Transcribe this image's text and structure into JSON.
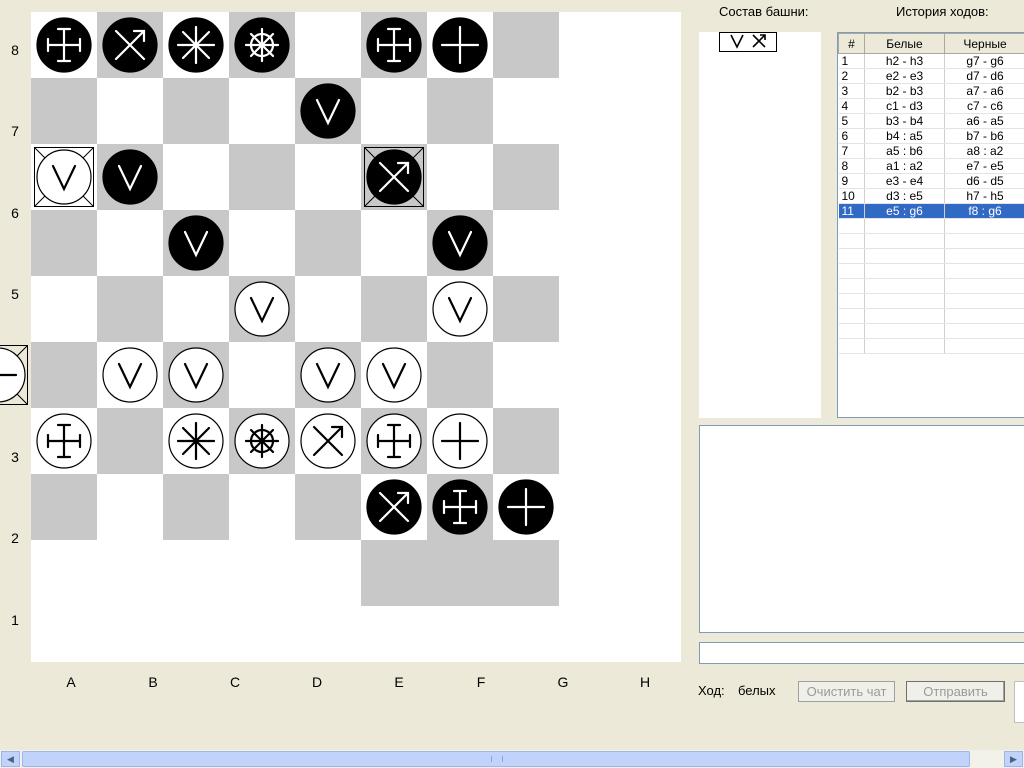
{
  "board": {
    "ranks": [
      "8",
      "7",
      "6",
      "5",
      "4",
      "3",
      "2",
      "1"
    ],
    "files": [
      "A",
      "B",
      "C",
      "D",
      "E",
      "F",
      "G",
      "H"
    ],
    "pieces": [
      {
        "sq": "b8",
        "color": "black",
        "type": "cross-bars",
        "tower": false
      },
      {
        "sq": "c8",
        "color": "black",
        "type": "arrow",
        "tower": false
      },
      {
        "sq": "d8",
        "color": "black",
        "type": "star",
        "tower": false
      },
      {
        "sq": "e8",
        "color": "black",
        "type": "wheel",
        "tower": false
      },
      {
        "sq": "g8",
        "color": "black",
        "type": "cross-bars",
        "tower": false
      },
      {
        "sq": "h8",
        "color": "black",
        "type": "plus",
        "tower": false
      },
      {
        "sq": "f7",
        "color": "black",
        "type": "v",
        "tower": false
      },
      {
        "sq": "b6",
        "color": "white",
        "type": "v",
        "tower": true
      },
      {
        "sq": "c6",
        "color": "black",
        "type": "v",
        "tower": false
      },
      {
        "sq": "g6",
        "color": "black",
        "type": "arrow",
        "tower": true
      },
      {
        "sq": "d5",
        "color": "black",
        "type": "v",
        "tower": false
      },
      {
        "sq": "h5",
        "color": "black",
        "type": "v",
        "tower": false
      },
      {
        "sq": "e4",
        "color": "white",
        "type": "v",
        "tower": false
      },
      {
        "sq": "h4",
        "color": "white",
        "type": "v",
        "tower": false
      },
      {
        "sq": "a3",
        "color": "white",
        "type": "plus",
        "tower": true
      },
      {
        "sq": "c3",
        "color": "white",
        "type": "v",
        "tower": false
      },
      {
        "sq": "d3",
        "color": "white",
        "type": "v",
        "tower": false
      },
      {
        "sq": "f3",
        "color": "white",
        "type": "v",
        "tower": false
      },
      {
        "sq": "g3",
        "color": "white",
        "type": "v",
        "tower": false
      },
      {
        "sq": "b2",
        "color": "white",
        "type": "cross-bars",
        "tower": false
      },
      {
        "sq": "d2",
        "color": "white",
        "type": "star",
        "tower": false
      },
      {
        "sq": "e2",
        "color": "white",
        "type": "wheel",
        "tower": false
      },
      {
        "sq": "f2",
        "color": "white",
        "type": "arrow",
        "tower": false
      },
      {
        "sq": "g2",
        "color": "white",
        "type": "cross-bars",
        "tower": false
      },
      {
        "sq": "h2",
        "color": "white",
        "type": "plus",
        "tower": false
      },
      {
        "sq": "g1",
        "color": "black",
        "type": "arrow",
        "tower": false
      },
      {
        "sq": "h1",
        "color": "black",
        "type": "cross-bars",
        "tower": false
      },
      {
        "sq": "i1",
        "color": "black",
        "type": "plus",
        "tower": false
      }
    ]
  },
  "panel": {
    "tower_title": "Состав башни:",
    "history_title": "История ходов:",
    "tower_icons": [
      "v-icon",
      "arrow-icon"
    ]
  },
  "history": {
    "columns": [
      "#",
      "Белые",
      "Черные"
    ],
    "rows": [
      [
        "1",
        "h2 - h3",
        "g7 - g6"
      ],
      [
        "2",
        "e2 - e3",
        "d7 - d6"
      ],
      [
        "3",
        "b2 - b3",
        "a7 - a6"
      ],
      [
        "4",
        "c1 - d3",
        "c7 - c6"
      ],
      [
        "5",
        "b3 - b4",
        "a6 - a5"
      ],
      [
        "6",
        "b4 : a5",
        "b7 - b6"
      ],
      [
        "7",
        "a5 : b6",
        "a8 : a2"
      ],
      [
        "8",
        "a1 : a2",
        "e7 - e5"
      ],
      [
        "9",
        "e3 - e4",
        "d6 - d5"
      ],
      [
        "10",
        "d3 : e5",
        "h7 - h5"
      ],
      [
        "11",
        "e5 : g6",
        "f8 : g6"
      ]
    ],
    "selected_row": 10,
    "empty_rows": 9
  },
  "chat": {
    "input_value": "",
    "turn_label": "Ход:",
    "turn_value": "белых",
    "clear_button": "Очистить чат",
    "send_button": "Отправить"
  },
  "colors": {
    "dark_square": "#c8c8c8",
    "light_square": "#ffffff",
    "selection": "#316ac5",
    "window_bg": "#ece9d8"
  }
}
